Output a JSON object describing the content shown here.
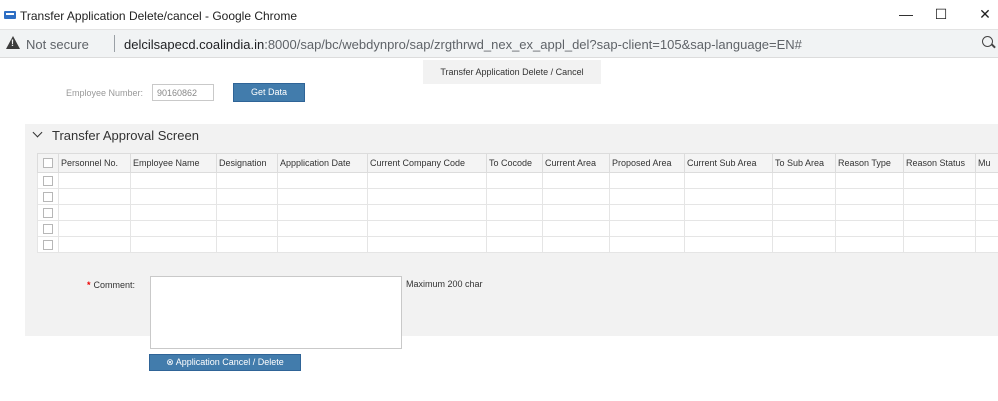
{
  "window": {
    "title": "Transfer Application Delete/cancel - Google Chrome",
    "minimize": "—",
    "maximize": "☐",
    "close": "✕"
  },
  "address": {
    "security": "Not secure",
    "host": "delcilsapecd.coalindia.in",
    "path": ":8000/sap/bc/webdynpro/sap/zrgthrwd_nex_ex_appl_del?sap-client=105&sap-language=EN#"
  },
  "page": {
    "title": "Transfer Application Delete / Cancel"
  },
  "employee": {
    "label": "Employee Number:",
    "value": "90160862",
    "get_data": "Get Data"
  },
  "panel": {
    "title": "Transfer Approval Screen",
    "columns": [
      "Personnel No.",
      "Employee Name",
      "Designation",
      "Appplication Date",
      "Current Company Code",
      "To Cocode",
      "Current Area",
      "Proposed Area",
      "Current Sub Area",
      "To Sub Area",
      "Reason Type",
      "Reason Status",
      "Mu"
    ],
    "row_count": 5
  },
  "comment": {
    "label": "Comment:",
    "value": "",
    "max_note": "Maximum 200 char"
  },
  "cancel_button": {
    "label": "Application Cancel / Delete",
    "icon": "cancel-circle-icon"
  }
}
